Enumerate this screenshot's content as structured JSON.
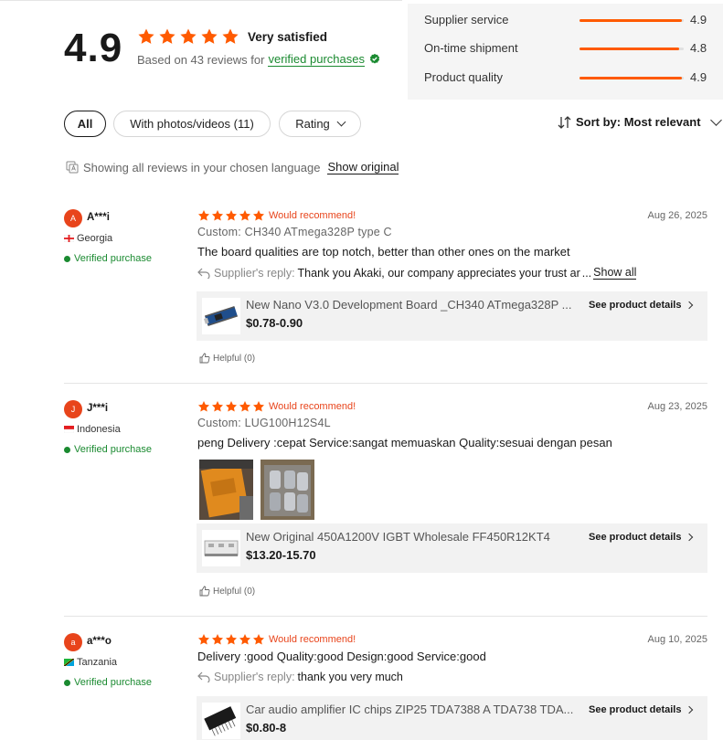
{
  "summary": {
    "score": "4.9",
    "rating_stars": 5,
    "satisfaction": "Very satisfied",
    "based_on": "Based on 43 reviews for",
    "verified_link": "verified purchases"
  },
  "metrics": [
    {
      "name": "Supplier service",
      "value": "4.9",
      "fill": 0.98
    },
    {
      "name": "On-time shipment",
      "value": "4.8",
      "fill": 0.96
    },
    {
      "name": "Product quality",
      "value": "4.9",
      "fill": 0.98
    }
  ],
  "filters": {
    "all": "All",
    "photos": "With photos/videos (11)",
    "rating": "Rating",
    "sort": "Sort by: Most relevant"
  },
  "language_note": {
    "text": "Showing all reviews in your chosen language",
    "link": "Show original"
  },
  "colors": {
    "accent": "#ff5a00",
    "star": "#ff5a00",
    "verified": "#1a8a30",
    "recommend": "#e8441b"
  },
  "reviews": [
    {
      "initial": "A",
      "name": "A***i",
      "country": "Georgia",
      "verified": "Verified purchase",
      "stars": 5,
      "recommend": "Would recommend!",
      "date": "Aug 26, 2025",
      "custom": "Custom:  CH340 ATmega328P type C",
      "text": "The board qualities are top notch, better than other ones on the market",
      "reply_label": "Supplier's reply:",
      "reply_text": "Thank you Akaki, our company appreciates your trust ar",
      "reply_more": "Show all",
      "product_title": "New Nano V3.0 Development Board _CH340 ATmega328P ...",
      "product_price": "$0.78-0.90",
      "product_link": "See product details",
      "helpful": "Helpful (0)"
    },
    {
      "initial": "J",
      "name": "J***i",
      "country": "Indonesia",
      "verified": "Verified purchase",
      "stars": 5,
      "recommend": "Would recommend!",
      "date": "Aug 23, 2025",
      "custom": "Custom:  LUG100H12S4L",
      "text": "peng Delivery :cepat Service:sangat memuaskan Quality:sesuai dengan pesan",
      "product_title": "New Original 450A1200V IGBT Wholesale FF450R12KT4",
      "product_price": "$13.20-15.70",
      "product_link": "See product details",
      "helpful": "Helpful (0)"
    },
    {
      "initial": "a",
      "name": "a***o",
      "country": "Tanzania",
      "verified": "Verified purchase",
      "stars": 5,
      "recommend": "Would recommend!",
      "date": "Aug 10, 2025",
      "text": "Delivery :good Quality:good Design:good Service:good",
      "reply_label": "Supplier's reply:",
      "reply_text": "thank you very much",
      "product_title": "Car audio amplifier IC chips ZIP25 TDA7388 A TDA738 TDA...",
      "product_price": "$0.80-8",
      "product_link": "See product details"
    }
  ]
}
